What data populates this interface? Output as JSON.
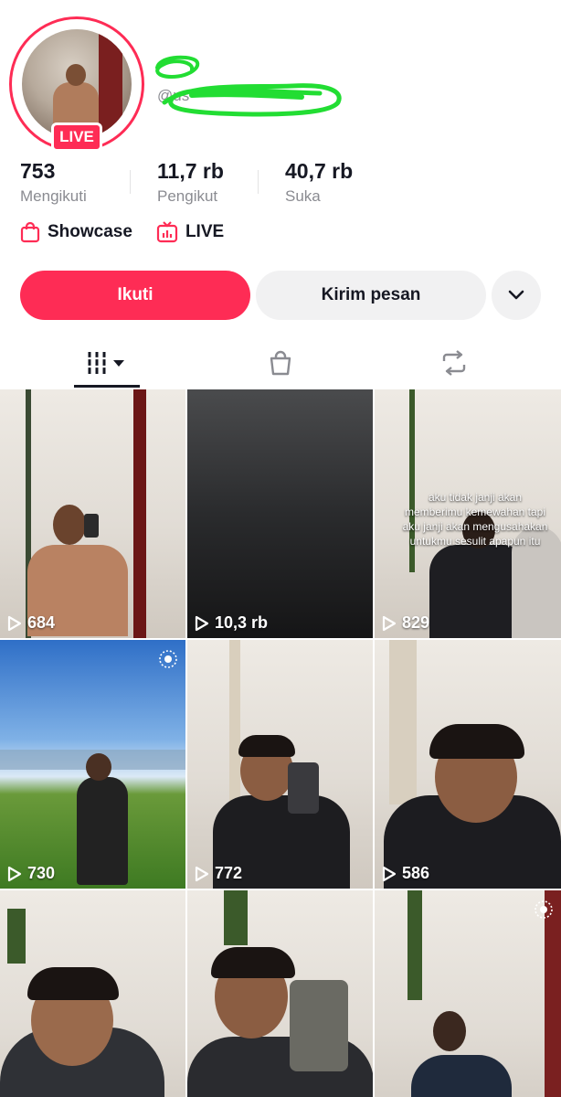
{
  "profile": {
    "live_badge": "LIVE",
    "handle_prefix": "@us"
  },
  "stats": [
    {
      "value": "753",
      "label": "Mengikuti"
    },
    {
      "value": "11,7 rb",
      "label": "Pengikut"
    },
    {
      "value": "40,7 rb",
      "label": "Suka"
    }
  ],
  "links": {
    "showcase": "Showcase",
    "live": "LIVE"
  },
  "actions": {
    "follow": "Ikuti",
    "message": "Kirim pesan"
  },
  "grid": [
    {
      "views": "684"
    },
    {
      "views": "10,3 rb"
    },
    {
      "views": "829",
      "caption": "aku tidak janji akan memberimu kemewahan tapi aku janji akan mengusahakan untukmu sesulit apapun itu"
    },
    {
      "views": "730"
    },
    {
      "views": "772"
    },
    {
      "views": "586"
    },
    {
      "views": ""
    },
    {
      "views": ""
    },
    {
      "views": ""
    }
  ],
  "colors": {
    "accent": "#fe2c55",
    "text": "#161823",
    "muted": "#8a8b91",
    "button_gray": "#f1f1f2",
    "scribble": "#22dd33"
  }
}
